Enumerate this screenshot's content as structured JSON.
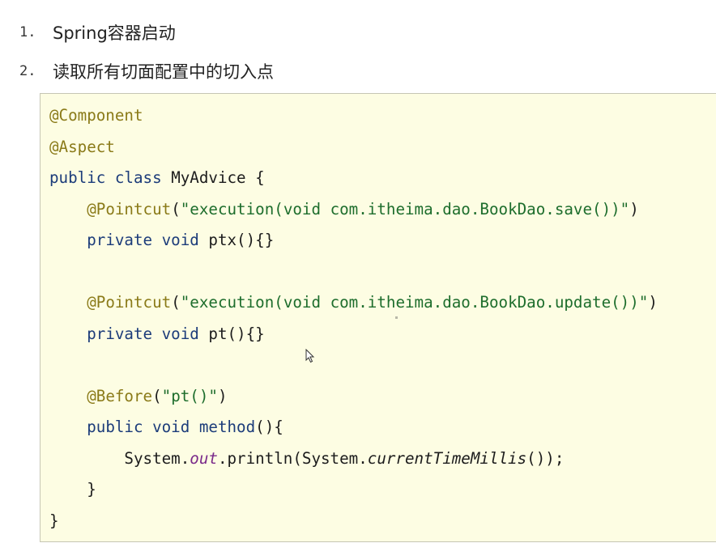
{
  "list": {
    "items": [
      {
        "number": "1.",
        "text": "Spring容器启动"
      },
      {
        "number": "2.",
        "text": "读取所有切面配置中的切入点"
      }
    ]
  },
  "code": {
    "lines": [
      {
        "tokens": [
          {
            "t": "@Component",
            "c": "ann"
          }
        ]
      },
      {
        "tokens": [
          {
            "t": "@Aspect",
            "c": "ann"
          }
        ]
      },
      {
        "tokens": [
          {
            "t": "public class ",
            "c": "kw"
          },
          {
            "t": "MyAdvice {",
            "c": ""
          }
        ]
      },
      {
        "tokens": [
          {
            "t": "    ",
            "c": ""
          },
          {
            "t": "@Pointcut",
            "c": "ann"
          },
          {
            "t": "(",
            "c": ""
          },
          {
            "t": "\"execution(void com.itheima.dao.BookDao.save())\"",
            "c": "str"
          },
          {
            "t": ")",
            "c": ""
          }
        ]
      },
      {
        "tokens": [
          {
            "t": "    ",
            "c": ""
          },
          {
            "t": "private void ",
            "c": "kw"
          },
          {
            "t": "ptx(){}",
            "c": ""
          }
        ]
      },
      {
        "tokens": []
      },
      {
        "tokens": [
          {
            "t": "    ",
            "c": ""
          },
          {
            "t": "@Pointcut",
            "c": "ann"
          },
          {
            "t": "(",
            "c": ""
          },
          {
            "t": "\"execution(void com.itheima.dao.BookDao.update())\"",
            "c": "str"
          },
          {
            "t": ")",
            "c": ""
          }
        ]
      },
      {
        "tokens": [
          {
            "t": "    ",
            "c": ""
          },
          {
            "t": "private void ",
            "c": "kw"
          },
          {
            "t": "pt(){}",
            "c": ""
          }
        ]
      },
      {
        "tokens": []
      },
      {
        "tokens": [
          {
            "t": "    ",
            "c": ""
          },
          {
            "t": "@Before",
            "c": "ann"
          },
          {
            "t": "(",
            "c": ""
          },
          {
            "t": "\"pt()\"",
            "c": "str"
          },
          {
            "t": ")",
            "c": ""
          }
        ]
      },
      {
        "tokens": [
          {
            "t": "    ",
            "c": ""
          },
          {
            "t": "public void ",
            "c": "kw"
          },
          {
            "t": "method",
            "c": "kw"
          },
          {
            "t": "(){",
            "c": ""
          }
        ]
      },
      {
        "tokens": [
          {
            "t": "        System.",
            "c": ""
          },
          {
            "t": "out",
            "c": "fld"
          },
          {
            "t": ".println(System.",
            "c": ""
          },
          {
            "t": "currentTimeMillis",
            "c": "it"
          },
          {
            "t": "());",
            "c": ""
          }
        ]
      },
      {
        "tokens": [
          {
            "t": "    }",
            "c": ""
          }
        ]
      },
      {
        "tokens": [
          {
            "t": "}",
            "c": ""
          }
        ]
      }
    ]
  },
  "colors": {
    "annotation": "#8a7a18",
    "keyword": "#1c3c7a",
    "string": "#1d6d2c",
    "static_field": "#7a2a8a",
    "code_background": "#fdfde3"
  },
  "icons": {
    "cursor": "mouse-pointer-icon"
  }
}
